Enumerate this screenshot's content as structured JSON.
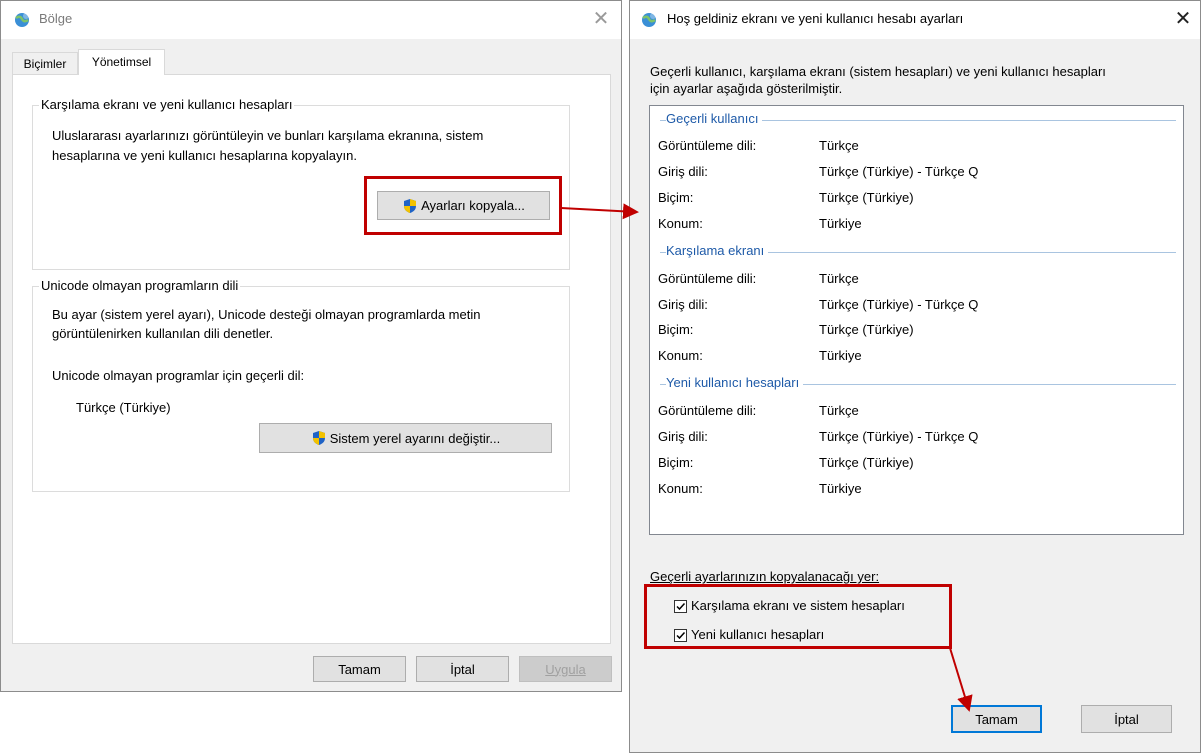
{
  "left_window": {
    "title": "Bölge",
    "close_glyph": "✕",
    "tabs": [
      "Biçimler",
      "Yönetimsel"
    ],
    "group1": {
      "title": "Karşılama ekranı ve yeni kullanıcı hesapları",
      "text_line1": "Uluslararası ayarlarınızı görüntüleyin ve bunları karşılama ekranına, sistem",
      "text_line2": "hesaplarına ve yeni kullanıcı hesaplarına kopyalayın.",
      "button": "Ayarları kopyala..."
    },
    "group2": {
      "title": "Unicode olmayan programların dili",
      "text_line1": "Bu ayar (sistem yerel ayarı), Unicode desteği olmayan programlarda metin",
      "text_line2": "görüntülenirken kullanılan dili denetler.",
      "current_label": "Unicode olmayan programlar için geçerli dil:",
      "current_value": "Türkçe (Türkiye)",
      "button": "Sistem yerel ayarını değiştir..."
    },
    "buttons": {
      "ok": "Tamam",
      "cancel": "İptal",
      "apply": "Uygula"
    }
  },
  "right_window": {
    "title": "Hoş geldiniz ekranı ve yeni kullanıcı hesabı ayarları",
    "close_glyph": "✕",
    "intro_line1": "Geçerli kullanıcı, karşılama ekranı (sistem hesapları) ve yeni kullanıcı hesapları",
    "intro_line2": "için ayarlar aşağıda gösterilmiştir.",
    "sections": [
      {
        "title": "Geçerli kullanıcı",
        "rows": [
          {
            "label": "Görüntüleme dili:",
            "value": "Türkçe"
          },
          {
            "label": "Giriş dili:",
            "value": "Türkçe (Türkiye) - Türkçe Q"
          },
          {
            "label": "Biçim:",
            "value": "Türkçe (Türkiye)"
          },
          {
            "label": "Konum:",
            "value": "Türkiye"
          }
        ]
      },
      {
        "title": "Karşılama ekranı",
        "rows": [
          {
            "label": "Görüntüleme dili:",
            "value": "Türkçe"
          },
          {
            "label": "Giriş dili:",
            "value": "Türkçe (Türkiye) - Türkçe Q"
          },
          {
            "label": "Biçim:",
            "value": "Türkçe (Türkiye)"
          },
          {
            "label": "Konum:",
            "value": "Türkiye"
          }
        ]
      },
      {
        "title": "Yeni kullanıcı hesapları",
        "rows": [
          {
            "label": "Görüntüleme dili:",
            "value": "Türkçe"
          },
          {
            "label": "Giriş dili:",
            "value": "Türkçe (Türkiye) - Türkçe Q"
          },
          {
            "label": "Biçim:",
            "value": "Türkçe (Türkiye)"
          },
          {
            "label": "Konum:",
            "value": "Türkiye"
          }
        ]
      }
    ],
    "copy_to_label": "Geçerli ayarlarınızın kopyalanacağı yer:",
    "checkboxes": [
      {
        "label": "Karşılama ekranı ve sistem hesapları",
        "checked": true
      },
      {
        "label": "Yeni kullanıcı hesapları",
        "checked": true
      }
    ],
    "buttons": {
      "ok": "Tamam",
      "cancel": "İptal"
    }
  },
  "colors": {
    "highlight": "#c00000",
    "section_title": "#1e5aa8",
    "focus_border": "#0078d7"
  }
}
